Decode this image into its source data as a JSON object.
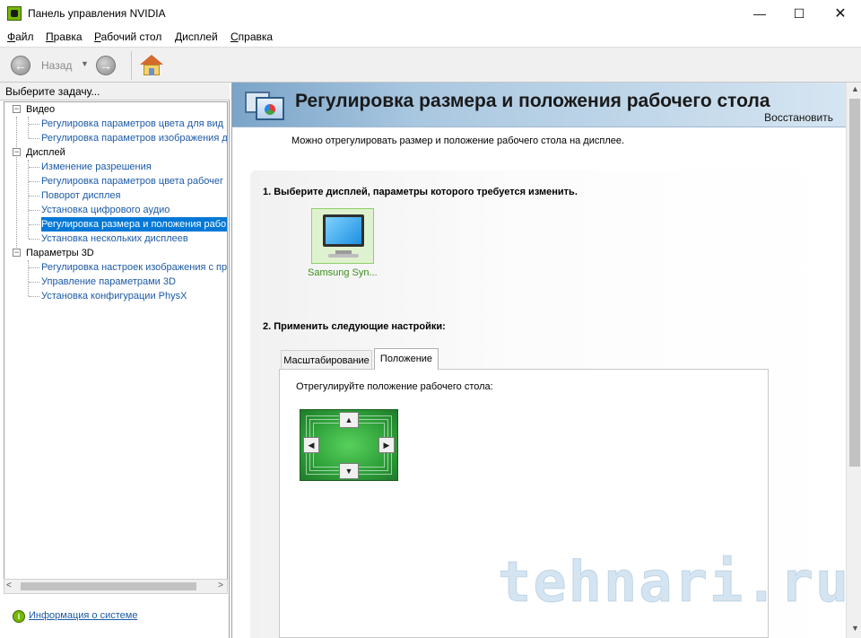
{
  "window": {
    "title": "Панель управления NVIDIA",
    "minimize": "—",
    "maximize": "☐",
    "close": "✕"
  },
  "menu": [
    "Файл",
    "Правка",
    "Рабочий стол",
    "Дисплей",
    "Справка"
  ],
  "toolbar": {
    "back_label": "Назад",
    "back_glyph": "←",
    "forward_glyph": "→",
    "dropdown_glyph": "▼"
  },
  "left_pane": {
    "header": "Выберите задачу...",
    "categories": [
      {
        "label": "Видео",
        "expander": "−",
        "items": [
          "Регулировка параметров цвета для вид",
          "Регулировка параметров изображения д"
        ]
      },
      {
        "label": "Дисплей",
        "expander": "−",
        "items": [
          "Изменение разрешения",
          "Регулировка параметров цвета рабочег",
          "Поворот дисплея",
          "Установка цифрового аудио",
          "Регулировка размера и положения рабо",
          "Установка нескольких дисплеев"
        ]
      },
      {
        "label": "Параметры 3D",
        "expander": "−",
        "items": [
          "Регулировка настроек изображения с пр",
          "Управление параметрами 3D",
          "Установка конфигурации PhysX"
        ]
      }
    ],
    "selected_item": "Регулировка размера и положения рабо",
    "scroll_left": "<",
    "scroll_right": ">",
    "system_info_link": "Информация о системе",
    "system_info_icon": "i"
  },
  "right_pane": {
    "page_title": "Регулировка размера и положения рабочего стола",
    "restore_label": "Восстановить",
    "description": "Можно отрегулировать размер и положение рабочего стола на дисплее.",
    "section1": "1. Выберите дисплей, параметры которого требуется изменить.",
    "display_name": "Samsung Syn...",
    "section2": "2. Применить следующие настройки:",
    "tabs": [
      {
        "label": "Масштабирование",
        "active": false
      },
      {
        "label": "Положение",
        "active": true
      }
    ],
    "tab_description": "Отрегулируйте положение рабочего стола:",
    "arrows": {
      "up": "▲",
      "down": "▼",
      "left": "◀",
      "right": "▶"
    },
    "scroll_up": "▲",
    "scroll_down": "▼"
  },
  "watermark": "tehnari.ru",
  "colors": {
    "selection": "#0078d7",
    "link": "#1c5aa6",
    "nvidia_green": "#76b900",
    "display_label": "#3a8f1a"
  }
}
